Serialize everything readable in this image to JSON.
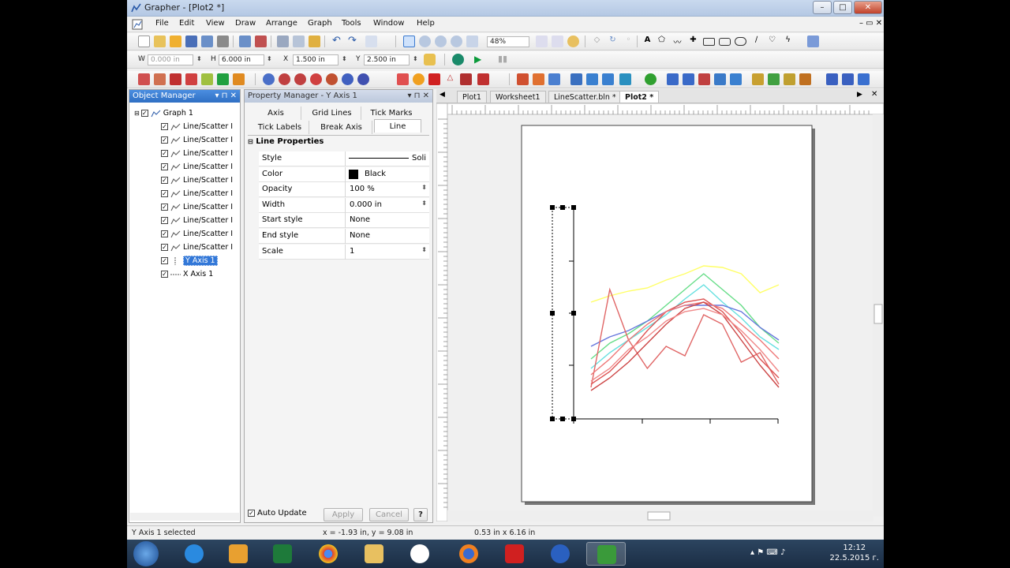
{
  "window": {
    "title": "Grapher - [Plot2 *]"
  },
  "menu": [
    "File",
    "Edit",
    "View",
    "Draw",
    "Arrange",
    "Graph",
    "Tools",
    "Window",
    "Help"
  ],
  "toolbar": {
    "zoom": "48%"
  },
  "position_bar": {
    "w_label": "W",
    "w_value": "0.000 in",
    "h_label": "H",
    "h_value": "6.000 in",
    "x_label": "X",
    "x_value": "1.500 in",
    "y_label": "Y",
    "y_value": "2.500 in"
  },
  "object_manager": {
    "title": "Object Manager",
    "root": "Graph 1",
    "items": [
      "Line/Scatter I",
      "Line/Scatter I",
      "Line/Scatter I",
      "Line/Scatter I",
      "Line/Scatter I",
      "Line/Scatter I",
      "Line/Scatter I",
      "Line/Scatter I",
      "Line/Scatter I",
      "Line/Scatter I"
    ],
    "y_axis": "Y Axis 1",
    "x_axis": "X Axis 1"
  },
  "property_manager": {
    "title": "Property Manager - Y Axis 1",
    "tabs_row1": [
      "Axis",
      "Grid Lines",
      "Tick Marks"
    ],
    "tabs_row2": [
      "Tick Labels",
      "Break Axis",
      "Line"
    ],
    "section": "Line Properties",
    "rows": [
      {
        "key": "Style",
        "value": "Soli"
      },
      {
        "key": "Color",
        "value": "Black"
      },
      {
        "key": "Opacity",
        "value": "100 %"
      },
      {
        "key": "Width",
        "value": "0.000 in"
      },
      {
        "key": "Start style",
        "value": "None"
      },
      {
        "key": "End style",
        "value": "None"
      },
      {
        "key": "Scale",
        "value": "1"
      }
    ],
    "auto_update": "Auto Update",
    "apply": "Apply",
    "cancel": "Cancel",
    "help": "?"
  },
  "doc_tabs": [
    "Plot1",
    "Worksheet1",
    "LineScatter.bln *",
    "Plot2 *"
  ],
  "status": {
    "selection": "Y Axis 1 selected",
    "cursor": "x = -1.93 in, y = 9.08 in",
    "size": "0.53 in x 6.16 in"
  },
  "clock": {
    "time": "12:12",
    "date": "22.5.2015 г."
  },
  "colors": {
    "accent": "#2f6fc4",
    "title_bar": "#b4c8e4"
  },
  "chart_data": {
    "type": "line",
    "title": "",
    "xlabel": "",
    "ylabel": "",
    "x": [
      0,
      1,
      2,
      3,
      4,
      5,
      6,
      7,
      8,
      9,
      10
    ],
    "ylim": [
      0,
      100
    ],
    "series": [
      {
        "color": "#ffff66",
        "values": [
          64,
          68,
          71,
          73,
          78,
          82,
          87,
          86,
          82,
          70,
          75
        ]
      },
      {
        "color": "#66dd88",
        "values": [
          28,
          38,
          44,
          52,
          62,
          72,
          82,
          72,
          62,
          48,
          38
        ]
      },
      {
        "color": "#66e0e0",
        "values": [
          22,
          32,
          40,
          48,
          56,
          66,
          75,
          64,
          54,
          42,
          34
        ]
      },
      {
        "color": "#6677dd",
        "values": [
          36,
          42,
          46,
          52,
          58,
          62,
          62,
          62,
          58,
          48,
          40
        ]
      },
      {
        "color": "#e06666",
        "values": [
          10,
          72,
          40,
          22,
          36,
          30,
          56,
          50,
          26,
          32,
          12
        ]
      },
      {
        "color": "#dd5555",
        "values": [
          12,
          20,
          32,
          46,
          58,
          64,
          66,
          58,
          44,
          28,
          16
        ]
      },
      {
        "color": "#ee7777",
        "values": [
          18,
          28,
          40,
          50,
          58,
          62,
          64,
          60,
          50,
          40,
          28
        ]
      },
      {
        "color": "#cc4444",
        "values": [
          8,
          16,
          26,
          38,
          50,
          60,
          64,
          56,
          40,
          24,
          10
        ]
      },
      {
        "color": "#f08888",
        "values": [
          14,
          22,
          34,
          42,
          52,
          58,
          60,
          56,
          46,
          34,
          20
        ]
      }
    ]
  }
}
